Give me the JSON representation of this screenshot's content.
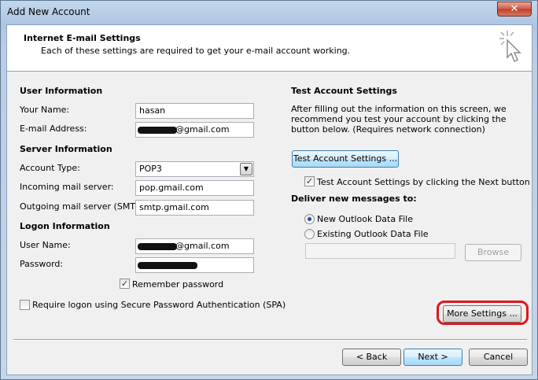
{
  "window": {
    "title": "Add New Account",
    "close_label": "✕"
  },
  "header": {
    "title": "Internet E-mail Settings",
    "subtitle": "Each of these settings are required to get your e-mail account working."
  },
  "user_info": {
    "section_title": "User Information",
    "your_name_label": "Your Name:",
    "your_name_value": "hasan",
    "email_label": "E-mail Address:",
    "email_value": "@gmail.com"
  },
  "server_info": {
    "section_title": "Server Information",
    "account_type_label": "Account Type:",
    "account_type_value": "POP3",
    "incoming_label": "Incoming mail server:",
    "incoming_value": "pop.gmail.com",
    "outgoing_label": "Outgoing mail server (SMTP):",
    "outgoing_value": "smtp.gmail.com"
  },
  "logon_info": {
    "section_title": "Logon Information",
    "username_label": "User Name:",
    "username_value": "@gmail.com",
    "password_label": "Password:",
    "password_value": "",
    "remember_label": "Remember password",
    "remember_checked": true,
    "spa_label": "Require logon using Secure Password Authentication (SPA)",
    "spa_checked": false
  },
  "test_settings": {
    "section_title": "Test Account Settings",
    "description": "After filling out the information on this screen, we recommend you test your account by clicking the button below. (Requires network connection)",
    "test_button_label": "Test Account Settings ...",
    "auto_test_label": "Test Account Settings by clicking the Next button",
    "auto_test_checked": true
  },
  "deliver": {
    "section_title": "Deliver new messages to:",
    "new_pst_label": "New Outlook Data File",
    "existing_pst_label": "Existing Outlook Data File",
    "existing_path_value": "",
    "browse_label": "Browse",
    "selected": "New Outlook Data File"
  },
  "footer": {
    "more_settings_label": "More Settings ...",
    "back_label": "< Back",
    "next_label": "Next >",
    "cancel_label": "Cancel"
  },
  "colors": {
    "highlight": "#e0161c",
    "accent": "#3c7fb1"
  },
  "icons": {
    "close": "close-icon",
    "cursor": "cursor-sparkle-icon",
    "dropdown": "chevron-down-icon",
    "check": "checkmark-icon"
  }
}
